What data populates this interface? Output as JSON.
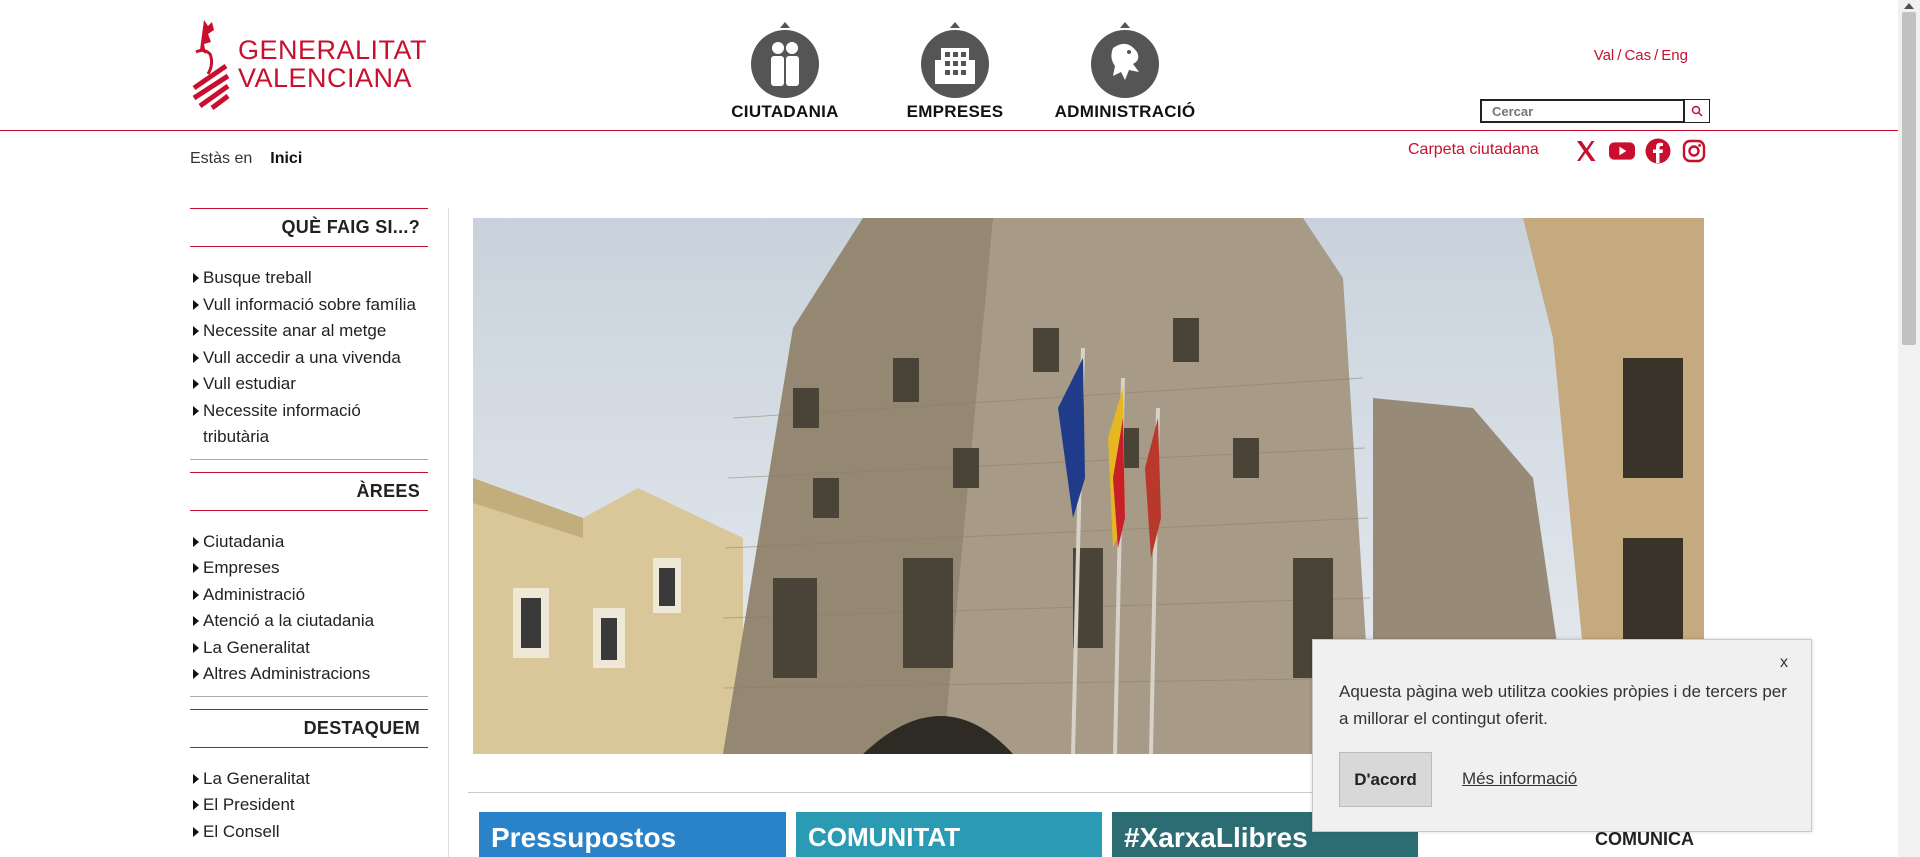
{
  "header": {
    "logo_line1": "GENERALITAT",
    "logo_line2": "VALENCIANA",
    "nav": [
      {
        "label": "CIUTADANIA",
        "icon": "people-icon"
      },
      {
        "label": "EMPRESES",
        "icon": "building-icon"
      },
      {
        "label": "ADMINISTRACIÓ",
        "icon": "dragon-icon"
      }
    ],
    "langs": [
      "Val",
      "Cas",
      "Eng"
    ],
    "search_placeholder": "Cercar"
  },
  "subheader": {
    "breadcrumb_prefix": "Estàs en",
    "breadcrumb_home": "Inici",
    "carpeta": "Carpeta ciutadana",
    "socials": [
      "x-icon",
      "youtube-icon",
      "facebook-icon",
      "instagram-icon"
    ]
  },
  "sidebar": {
    "sections": [
      {
        "title": "QUÈ FAIG SI...?",
        "items": [
          "Busque treball",
          "Vull informació sobre família",
          "Necessite anar al metge",
          "Vull accedir a una vivenda",
          "Vull estudiar",
          "Necessite informació tributària"
        ]
      },
      {
        "title": "ÀREES",
        "items": [
          "Ciutadania",
          "Empreses",
          "Administració",
          "Atenció a la ciutadania",
          "La Generalitat",
          "Altres Administracions"
        ]
      },
      {
        "title": "DESTAQUEM",
        "items": [
          "La Generalitat",
          "El President",
          "El Consell"
        ]
      }
    ]
  },
  "banners": [
    "Pressupostos",
    "COMUNITAT VALENCIANA",
    "#XarxaLlibres"
  ],
  "comunica": "COMUNICA",
  "cookie": {
    "close": "x",
    "message": "Aquesta pàgina web utilitza cookies pròpies i de tercers per a millorar el contingut oferit.",
    "accept": "D'acord",
    "more": "Més informació"
  },
  "colors": {
    "brand": "#c8102e",
    "nav_circle": "#555555"
  }
}
